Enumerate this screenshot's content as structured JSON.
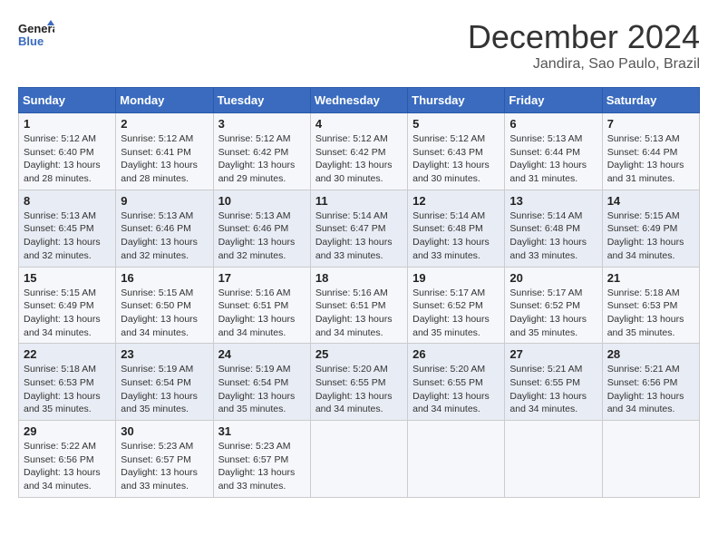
{
  "header": {
    "logo_line1": "General",
    "logo_line2": "Blue",
    "month_year": "December 2024",
    "location": "Jandira, Sao Paulo, Brazil"
  },
  "days_of_week": [
    "Sunday",
    "Monday",
    "Tuesday",
    "Wednesday",
    "Thursday",
    "Friday",
    "Saturday"
  ],
  "weeks": [
    [
      {
        "day": "1",
        "sunrise": "5:12 AM",
        "sunset": "6:40 PM",
        "daylight": "13 hours and 28 minutes."
      },
      {
        "day": "2",
        "sunrise": "5:12 AM",
        "sunset": "6:41 PM",
        "daylight": "13 hours and 28 minutes."
      },
      {
        "day": "3",
        "sunrise": "5:12 AM",
        "sunset": "6:42 PM",
        "daylight": "13 hours and 29 minutes."
      },
      {
        "day": "4",
        "sunrise": "5:12 AM",
        "sunset": "6:42 PM",
        "daylight": "13 hours and 30 minutes."
      },
      {
        "day": "5",
        "sunrise": "5:12 AM",
        "sunset": "6:43 PM",
        "daylight": "13 hours and 30 minutes."
      },
      {
        "day": "6",
        "sunrise": "5:13 AM",
        "sunset": "6:44 PM",
        "daylight": "13 hours and 31 minutes."
      },
      {
        "day": "7",
        "sunrise": "5:13 AM",
        "sunset": "6:44 PM",
        "daylight": "13 hours and 31 minutes."
      }
    ],
    [
      {
        "day": "8",
        "sunrise": "5:13 AM",
        "sunset": "6:45 PM",
        "daylight": "13 hours and 32 minutes."
      },
      {
        "day": "9",
        "sunrise": "5:13 AM",
        "sunset": "6:46 PM",
        "daylight": "13 hours and 32 minutes."
      },
      {
        "day": "10",
        "sunrise": "5:13 AM",
        "sunset": "6:46 PM",
        "daylight": "13 hours and 32 minutes."
      },
      {
        "day": "11",
        "sunrise": "5:14 AM",
        "sunset": "6:47 PM",
        "daylight": "13 hours and 33 minutes."
      },
      {
        "day": "12",
        "sunrise": "5:14 AM",
        "sunset": "6:48 PM",
        "daylight": "13 hours and 33 minutes."
      },
      {
        "day": "13",
        "sunrise": "5:14 AM",
        "sunset": "6:48 PM",
        "daylight": "13 hours and 33 minutes."
      },
      {
        "day": "14",
        "sunrise": "5:15 AM",
        "sunset": "6:49 PM",
        "daylight": "13 hours and 34 minutes."
      }
    ],
    [
      {
        "day": "15",
        "sunrise": "5:15 AM",
        "sunset": "6:49 PM",
        "daylight": "13 hours and 34 minutes."
      },
      {
        "day": "16",
        "sunrise": "5:15 AM",
        "sunset": "6:50 PM",
        "daylight": "13 hours and 34 minutes."
      },
      {
        "day": "17",
        "sunrise": "5:16 AM",
        "sunset": "6:51 PM",
        "daylight": "13 hours and 34 minutes."
      },
      {
        "day": "18",
        "sunrise": "5:16 AM",
        "sunset": "6:51 PM",
        "daylight": "13 hours and 34 minutes."
      },
      {
        "day": "19",
        "sunrise": "5:17 AM",
        "sunset": "6:52 PM",
        "daylight": "13 hours and 35 minutes."
      },
      {
        "day": "20",
        "sunrise": "5:17 AM",
        "sunset": "6:52 PM",
        "daylight": "13 hours and 35 minutes."
      },
      {
        "day": "21",
        "sunrise": "5:18 AM",
        "sunset": "6:53 PM",
        "daylight": "13 hours and 35 minutes."
      }
    ],
    [
      {
        "day": "22",
        "sunrise": "5:18 AM",
        "sunset": "6:53 PM",
        "daylight": "13 hours and 35 minutes."
      },
      {
        "day": "23",
        "sunrise": "5:19 AM",
        "sunset": "6:54 PM",
        "daylight": "13 hours and 35 minutes."
      },
      {
        "day": "24",
        "sunrise": "5:19 AM",
        "sunset": "6:54 PM",
        "daylight": "13 hours and 35 minutes."
      },
      {
        "day": "25",
        "sunrise": "5:20 AM",
        "sunset": "6:55 PM",
        "daylight": "13 hours and 34 minutes."
      },
      {
        "day": "26",
        "sunrise": "5:20 AM",
        "sunset": "6:55 PM",
        "daylight": "13 hours and 34 minutes."
      },
      {
        "day": "27",
        "sunrise": "5:21 AM",
        "sunset": "6:55 PM",
        "daylight": "13 hours and 34 minutes."
      },
      {
        "day": "28",
        "sunrise": "5:21 AM",
        "sunset": "6:56 PM",
        "daylight": "13 hours and 34 minutes."
      }
    ],
    [
      {
        "day": "29",
        "sunrise": "5:22 AM",
        "sunset": "6:56 PM",
        "daylight": "13 hours and 34 minutes."
      },
      {
        "day": "30",
        "sunrise": "5:23 AM",
        "sunset": "6:57 PM",
        "daylight": "13 hours and 33 minutes."
      },
      {
        "day": "31",
        "sunrise": "5:23 AM",
        "sunset": "6:57 PM",
        "daylight": "13 hours and 33 minutes."
      },
      null,
      null,
      null,
      null
    ]
  ]
}
